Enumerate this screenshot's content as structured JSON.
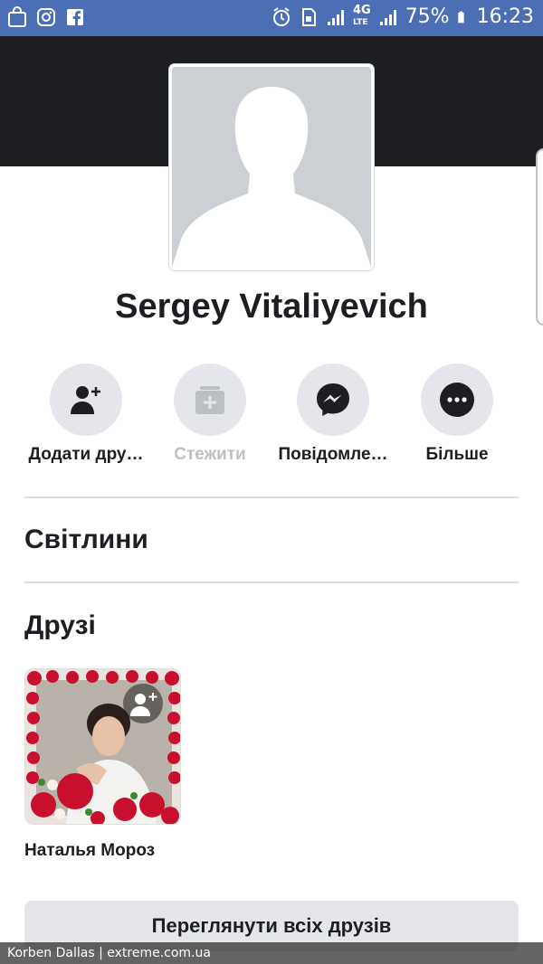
{
  "status_bar": {
    "battery": "75%",
    "time": "16:23",
    "network": "4G",
    "network_sub": "LTE",
    "icons_left": [
      "shopping-bag-icon",
      "instagram-icon",
      "facebook-icon"
    ],
    "icons_right": [
      "alarm-icon",
      "sim-icon",
      "signal-icon",
      "signal-icon",
      "battery-icon"
    ]
  },
  "profile": {
    "name": "Sergey Vitaliyevich"
  },
  "actions": [
    {
      "label": "Додати дру…",
      "icon": "add-friend-icon",
      "enabled": true
    },
    {
      "label": "Стежити",
      "icon": "follow-icon",
      "enabled": false
    },
    {
      "label": "Повідомле…",
      "icon": "messenger-icon",
      "enabled": true
    },
    {
      "label": "Більше",
      "icon": "more-icon",
      "enabled": true
    }
  ],
  "sections": {
    "photos_title": "Світлини",
    "friends_title": "Друзі"
  },
  "friends": [
    {
      "name": "Наталья Мороз"
    }
  ],
  "see_all_label": "Переглянути всіх друзів",
  "watermark": "Korben Dallas | extreme.com.ua",
  "colors": {
    "status_bar": "#4a6fb5",
    "cover": "#1d1f23",
    "button_bg": "#e4e6eb",
    "text": "#1c1e21",
    "disabled_text": "#bcc0c4"
  }
}
